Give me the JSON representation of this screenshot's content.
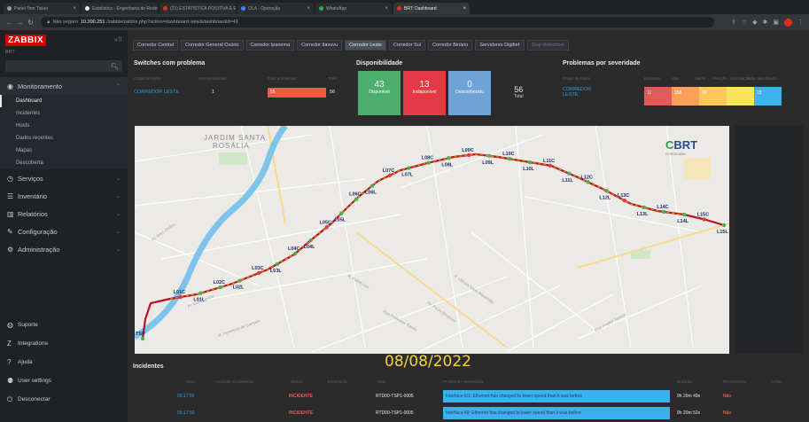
{
  "browser": {
    "tabs": [
      {
        "label": "Panel Tom Ticket",
        "color": "#9aa0a6"
      },
      {
        "label": "Estatística - Engenharia de Redes",
        "color": "#e8eaed"
      },
      {
        "label": "(21) ESTATÍSTICA POSITIVA E E...",
        "color": "#d93025"
      },
      {
        "label": "OLA - Operação",
        "color": "#4285f4"
      },
      {
        "label": "WhatsApp",
        "color": "#34a853"
      },
      {
        "label": "BRT: Dashboard",
        "color": "#d93025",
        "active": true
      }
    ],
    "url_prefix": "Não seguro",
    "url_host": "10.300.251",
    "url_path": "/zabbix/zabbix.php?action=dashboard.view&dashboardid=49"
  },
  "sidebar": {
    "logo": "ZABBIX",
    "host_label": "BRT",
    "menu": [
      {
        "label": "Monitoramento",
        "icon": "eye-icon",
        "glyph": "◉"
      },
      {
        "label": "Serviços",
        "icon": "clock-icon",
        "glyph": "◷"
      },
      {
        "label": "Inventário",
        "icon": "list-icon",
        "glyph": "☰"
      },
      {
        "label": "Relatórios",
        "icon": "chart-icon",
        "glyph": "▥"
      },
      {
        "label": "Configuração",
        "icon": "wrench-icon",
        "glyph": "✎"
      },
      {
        "label": "Administração",
        "icon": "gear-icon",
        "glyph": "⚙"
      }
    ],
    "submenu": [
      "Dashboard",
      "Incidentes",
      "Hosts",
      "Dados recentes",
      "Mapas",
      "Descoberta"
    ],
    "bottom": [
      {
        "label": "Suporte",
        "icon": "support-icon",
        "glyph": "◍"
      },
      {
        "label": "Integrations",
        "icon": "integrations-icon",
        "glyph": "Z"
      },
      {
        "label": "Ajuda",
        "icon": "help-icon",
        "glyph": "?"
      },
      {
        "label": "User settings",
        "icon": "user-icon",
        "glyph": "⚉"
      },
      {
        "label": "Desconectar",
        "icon": "logout-icon",
        "glyph": "⏻"
      }
    ]
  },
  "dashboard_tabs": [
    "Corredor Central",
    "Corredor General Osório",
    "Corredor Ipanema",
    "Corredor Itavuvu",
    "Corredor Leste",
    "Corredor Sul",
    "Corredor Binário",
    "Servidores Digifort",
    "Stop slideshow"
  ],
  "active_tab_index": 4,
  "switches": {
    "title": "Switches com problema",
    "headers": [
      "Grupo de hosts",
      "Sem problemas",
      "Com problemas",
      "Total"
    ],
    "group": "CORREDOR LESTE",
    "ok": "1",
    "problem": "55",
    "total": "56"
  },
  "availability": {
    "title": "Disponibilidade",
    "cells": [
      {
        "num": "43",
        "label": "Disponível",
        "color": "#4caf6e"
      },
      {
        "num": "13",
        "label": "Indisponível",
        "color": "#e63946"
      },
      {
        "num": "0",
        "label": "Desconhecido",
        "color": "#6fa3d6"
      }
    ],
    "total_num": "56",
    "total_label": "Total"
  },
  "severity": {
    "title": "Problemas por severidade",
    "headers": [
      "Grupo de hosts",
      "Desastre",
      "Alta",
      "Média",
      "Atenção",
      "Informação",
      "Não classificado"
    ],
    "group_line1": "CORREDOR",
    "group_line2": "LESTE",
    "cells": [
      {
        "value": "11",
        "color": "#e45959"
      },
      {
        "value": "158",
        "color": "#ffa059"
      },
      {
        "value": "90",
        "color": "#ffc859"
      },
      {
        "value": "",
        "color": "#f7e658"
      },
      {
        "value": "23",
        "color": "#3ab3ee"
      }
    ]
  },
  "map": {
    "districts": [
      "JARDIM SANTA",
      "ROSÁLIA"
    ],
    "logo_text_c": "C",
    "logo_text": "BRT",
    "logo_sub": "SOROCABA",
    "streets": [
      "Av. Dom Aguirre",
      "R. Humberto de Campos",
      "Av. Paulo Emanuel",
      "R. Padre Luiz",
      "R. Ulisses Nova Maranhão",
      "Rua Professor Toledo",
      "Av. Gen. Osório",
      "Rua Ângelo Taveiro"
    ],
    "stations": [
      "TSP",
      "L01C",
      "L01L",
      "L02C",
      "L02L",
      "L03C",
      "L03L",
      "L04C",
      "L04L",
      "L05C",
      "L05L",
      "L06C",
      "L06L",
      "L07C",
      "L07L",
      "L08C",
      "L08L",
      "L09C",
      "L09L",
      "L10C",
      "L10L",
      "L11C",
      "L11L",
      "L12C",
      "L12L",
      "L13C",
      "L13L",
      "L14C",
      "L14L",
      "L15C",
      "L15L"
    ]
  },
  "incidents": {
    "title": "Incidentes",
    "headers": [
      "Hora",
      "Hora da recuperação",
      "Status",
      "Informação",
      "Host",
      "Problema • Severidade",
      "Duração",
      "Reconhecido",
      "Ações"
    ],
    "date_overlay": "08/08/2022",
    "rows": [
      {
        "time": "09:17:50",
        "status": "INCIDENTE",
        "host": "RTD00-TSP1-0005",
        "problem": "Interface 6/1: Ethernet has changed to lower speed than it was before",
        "duration": "9h 20m 49s",
        "ack": "Não"
      },
      {
        "time": "09:17:50",
        "status": "INCIDENTE",
        "host": "RTD00-TSP1-0005",
        "problem": "Interface 49: Ethernet has changed to lower speed than it was before",
        "duration": "9h 20m 52s",
        "ack": "Não"
      }
    ]
  }
}
